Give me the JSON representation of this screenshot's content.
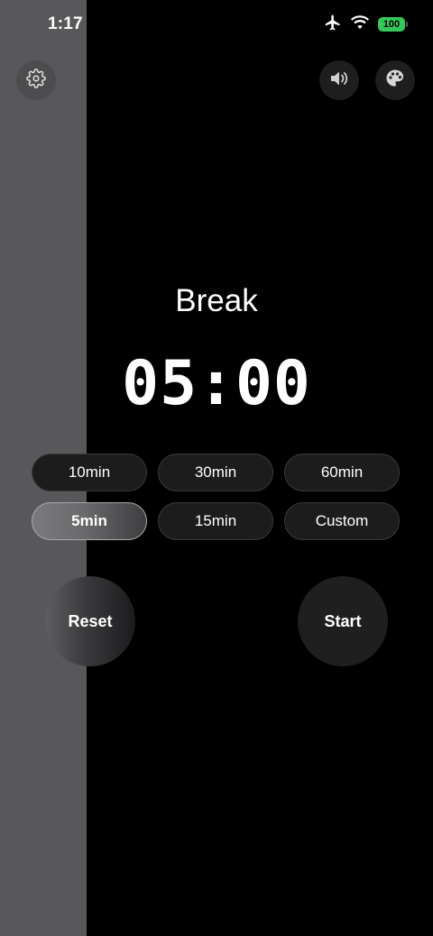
{
  "status_bar": {
    "time": "1:17",
    "battery_level": "100",
    "icons": [
      "airplane-icon",
      "wifi-icon",
      "battery-icon"
    ]
  },
  "toolbar": {
    "icons": [
      "gear-icon",
      "speaker-icon",
      "palette-icon"
    ]
  },
  "timer": {
    "mode": "Break",
    "display": "05:00",
    "elapsed_fraction": 0.2
  },
  "presets": [
    {
      "label": "10min",
      "selected": false
    },
    {
      "label": "30min",
      "selected": false
    },
    {
      "label": "60min",
      "selected": false
    },
    {
      "label": "5min",
      "selected": true
    },
    {
      "label": "15min",
      "selected": false
    },
    {
      "label": "Custom",
      "selected": false
    }
  ],
  "controls": {
    "reset_label": "Reset",
    "start_label": "Start"
  },
  "colors": {
    "background": "#000000",
    "progress": "#58585a",
    "battery": "#34c759"
  }
}
